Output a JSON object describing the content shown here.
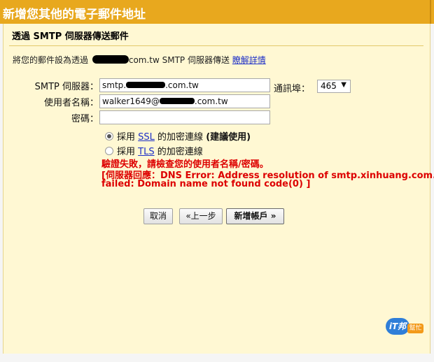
{
  "window": {
    "title": "新增您其他的電子郵件地址"
  },
  "section": {
    "title": "透過 SMTP 伺服器傳送郵件",
    "info_prefix": "將您的郵件設為透過",
    "info_suffix": "com.tw SMTP 伺服器傳送",
    "info_link": "瞭解詳情"
  },
  "form": {
    "smtp_label": "SMTP 伺服器：",
    "smtp_value_prefix": "smtp.",
    "smtp_value_suffix": ".com.tw",
    "port_label": "通訊埠：",
    "port_value": "465",
    "user_label": "使用者名稱：",
    "user_value_prefix": "walker1649@",
    "user_value_suffix": ".com.tw",
    "password_label": "密碼：",
    "password_value": ""
  },
  "options": {
    "ssl_prefix": "採用",
    "ssl_link": "SSL",
    "ssl_suffix": "的加密連線",
    "ssl_recommend": "(建議使用)",
    "ssl_selected": true,
    "tls_prefix": "採用",
    "tls_link": "TLS",
    "tls_suffix": "的加密連線",
    "tls_selected": false
  },
  "error": {
    "line1": "驗證失敗，請檢查您的使用者名稱/密碼。",
    "line2": "[伺服器回應：DNS Error: Address resolution of smtp.xinhuang.com.tw.",
    "line3": "failed: Domain name not found code(0) ]"
  },
  "buttons": {
    "cancel": "取消",
    "back": "«上一步",
    "add": "新增帳戶 »"
  },
  "badge": {
    "main": "iT邦",
    "tag": "幫忙"
  },
  "colors": {
    "titlebar": "#e8a81e",
    "panel": "#fff8d3",
    "link": "#1d2fc7",
    "error": "#dd0000"
  }
}
